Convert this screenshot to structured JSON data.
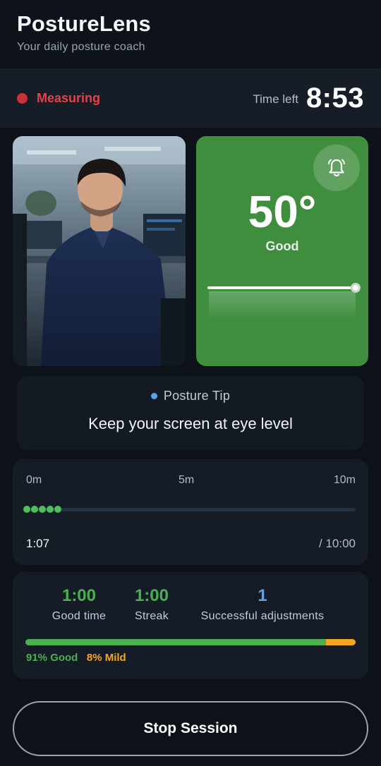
{
  "header": {
    "title": "PostureLens",
    "subtitle": "Your daily posture coach"
  },
  "status": {
    "label": "Measuring",
    "time_left_label": "Time left",
    "time_left_value": "8:53",
    "indicator_color": "#c8323a"
  },
  "camera": {
    "description_icon": "camera-feed"
  },
  "angle": {
    "value": "50°",
    "label": "Good",
    "card_color": "#3f8e3e",
    "alert_icon": "bell-icon"
  },
  "tip": {
    "heading": "Posture Tip",
    "text": "Keep your screen at eye level"
  },
  "timeline": {
    "start_label": "0m",
    "mid_label": "5m",
    "end_label": "10m",
    "elapsed": "1:07",
    "total": "/ 10:00",
    "progress_dots": 5
  },
  "stats": {
    "good_time_value": "1:00",
    "good_time_label": "Good time",
    "streak_value": "1:00",
    "streak_label": "Streak",
    "adjustments_value": "1",
    "adjustments_label": "Successful adjustments",
    "good_percent": 91,
    "mild_percent": 8,
    "good_legend": "91% Good",
    "mild_legend": "8% Mild",
    "colors": {
      "good": "#4caf50",
      "mild": "#f5a623",
      "adjust": "#5aa3ef"
    }
  },
  "actions": {
    "stop_label": "Stop Session"
  }
}
